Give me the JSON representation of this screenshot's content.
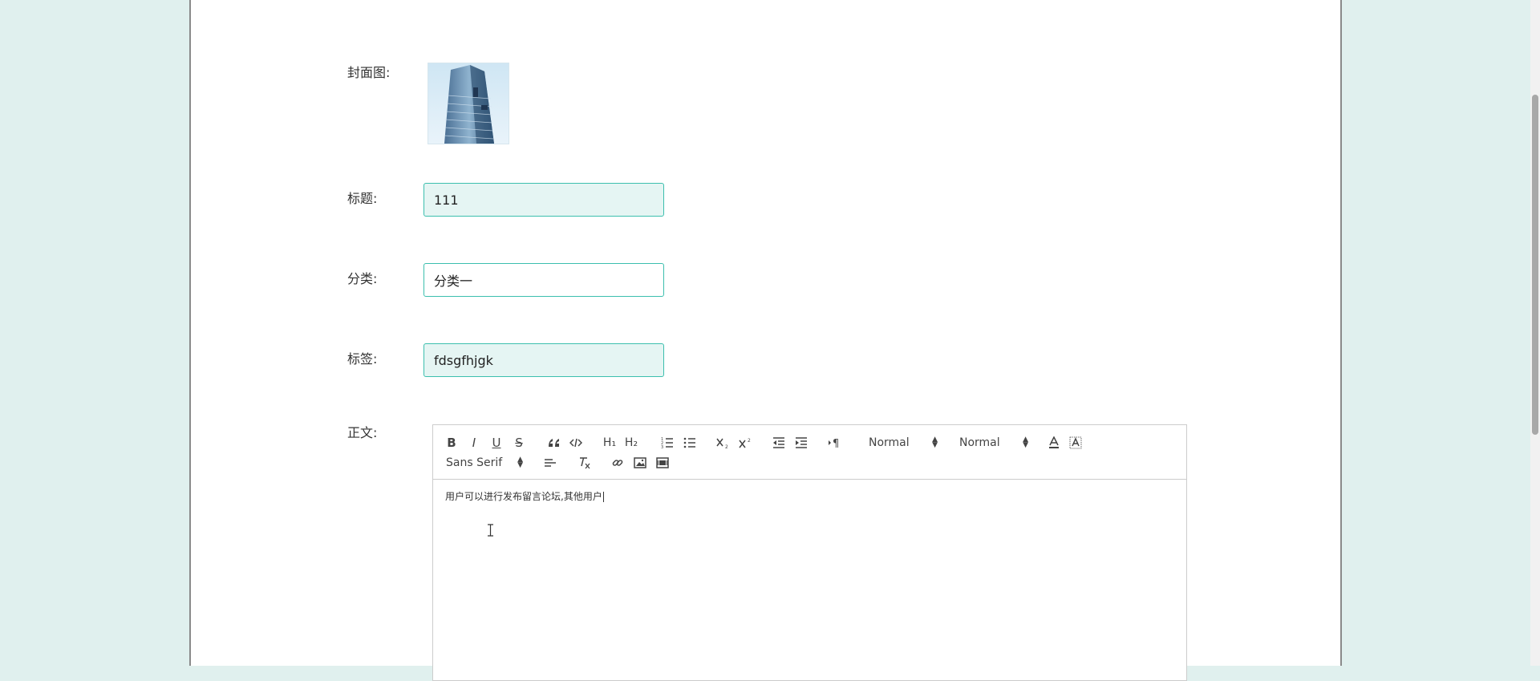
{
  "form": {
    "cover_label": "封面图:",
    "title_label": "标题:",
    "title_value": "111",
    "category_label": "分类:",
    "category_value": "分类一",
    "tags_label": "标签:",
    "tags_value": "fdsgfhjgk",
    "body_label": "正文:"
  },
  "editor": {
    "header_picker": "Normal",
    "size_picker": "Normal",
    "font_picker": "Sans Serif",
    "content": "用户可以进行发布留言论坛,其他用户"
  },
  "icons": {
    "bold": "B",
    "italic": "I",
    "underline": "U",
    "strike": "S",
    "h1": "H₁",
    "h2": "H₂"
  },
  "colors": {
    "background": "#e0f0ee",
    "accent": "#3cbfae",
    "field_fill": "#e5f5f3"
  }
}
